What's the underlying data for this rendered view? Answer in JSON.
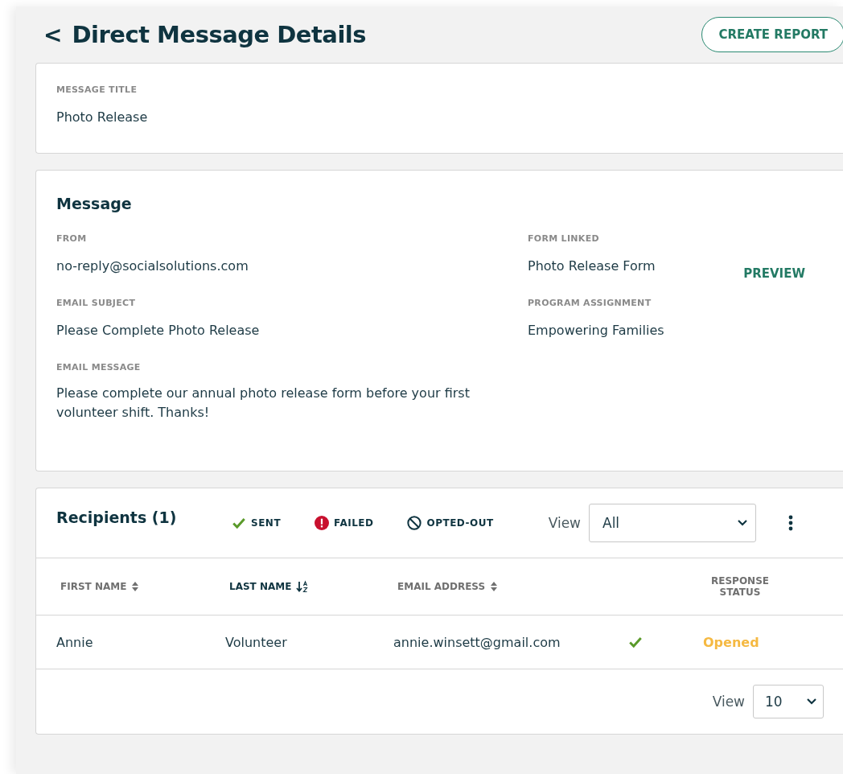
{
  "header": {
    "back": "<",
    "title": "Direct Message Details",
    "action": "CREATE REPORT"
  },
  "title_card": {
    "label": "MESSAGE TITLE",
    "value": "Photo Release"
  },
  "message": {
    "heading": "Message",
    "left": [
      {
        "label": "FROM",
        "value": "no-reply@socialsolutions.com"
      },
      {
        "label": "EMAIL SUBJECT",
        "value": "Please Complete Photo Release"
      },
      {
        "label": "EMAIL MESSAGE",
        "value": "Please complete our annual photo release form before your first volunteer shift. Thanks!"
      }
    ],
    "right": [
      {
        "label": "FORM LINKED",
        "value": "Photo Release Form",
        "link": "PREVIEW"
      },
      {
        "label": "PROGRAM ASSIGNMENT",
        "value": "Empowering Families"
      }
    ]
  },
  "recipients": {
    "heading": "Recipients (1)",
    "legend": [
      {
        "kind": "sent",
        "label": "SENT"
      },
      {
        "kind": "failed",
        "label": "FAILED"
      },
      {
        "kind": "opted-out",
        "label": "OPTED-OUT"
      }
    ],
    "view_label": "View",
    "view_value": "All",
    "columns": [
      {
        "label": "FIRST NAME",
        "kind": "sortable",
        "active": false
      },
      {
        "label": "LAST NAME",
        "kind": "sorted",
        "active": true
      },
      {
        "label": "EMAIL ADDRESS",
        "kind": "sortable",
        "active": false
      },
      {
        "label": "RESPONSE STATUS",
        "kind": "plain",
        "active": false
      }
    ],
    "rows": [
      {
        "first": "Annie",
        "last": "Volunteer",
        "email": "annie.winsett@gmail.com",
        "status_icon": {
          "kind": "sent"
        },
        "response": "Opened"
      }
    ],
    "page_view_label": "View",
    "page_view_value": "10"
  }
}
